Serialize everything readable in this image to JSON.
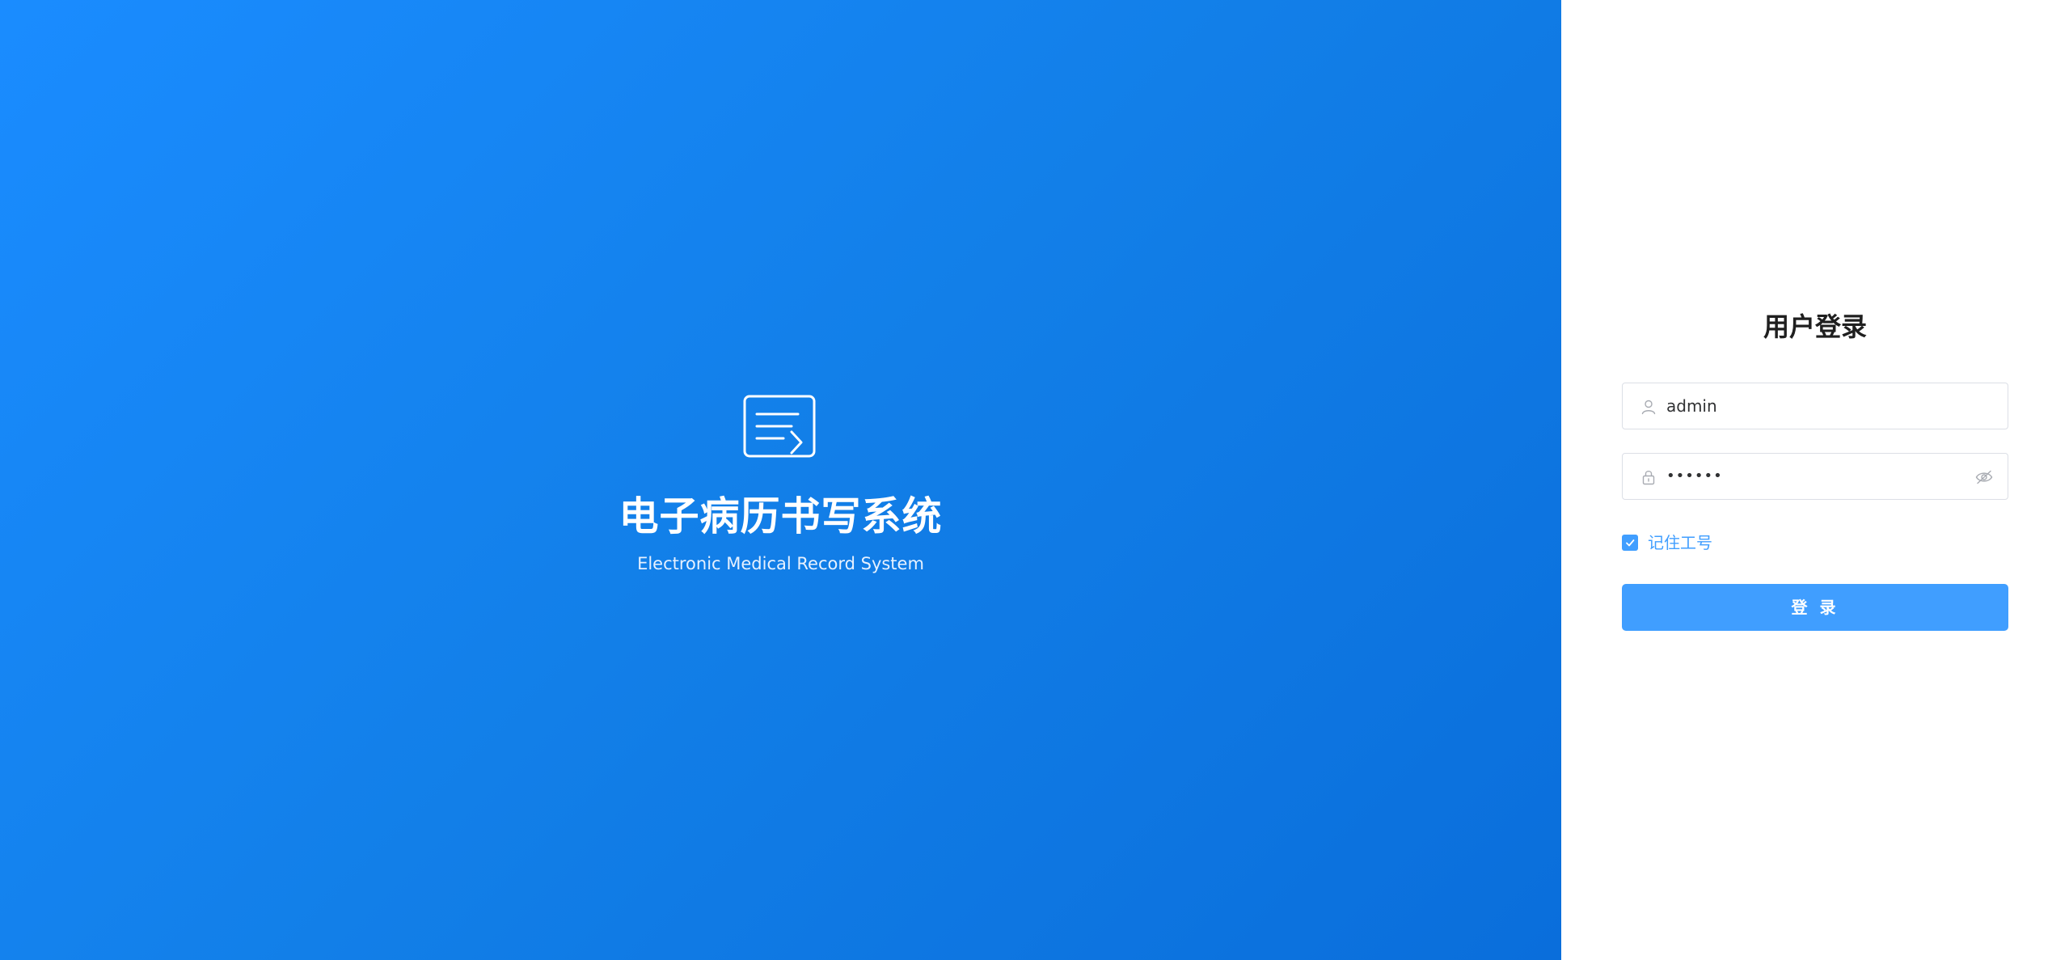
{
  "hero": {
    "icon": "document-edit-icon",
    "title": "电子病历书写系统",
    "subtitle": "Electronic Medical Record System",
    "gradient_start": "#1a8cff",
    "gradient_end": "#0a6edb"
  },
  "login": {
    "title": "用户登录",
    "username": {
      "icon": "user-icon",
      "value": "admin"
    },
    "password": {
      "icon": "lock-icon",
      "masked_value": "••••••",
      "toggle_icon": "eye-hidden-icon"
    },
    "remember": {
      "checked": true,
      "label": "记住工号"
    },
    "submit_label": "登 录",
    "accent_color": "#409eff"
  }
}
